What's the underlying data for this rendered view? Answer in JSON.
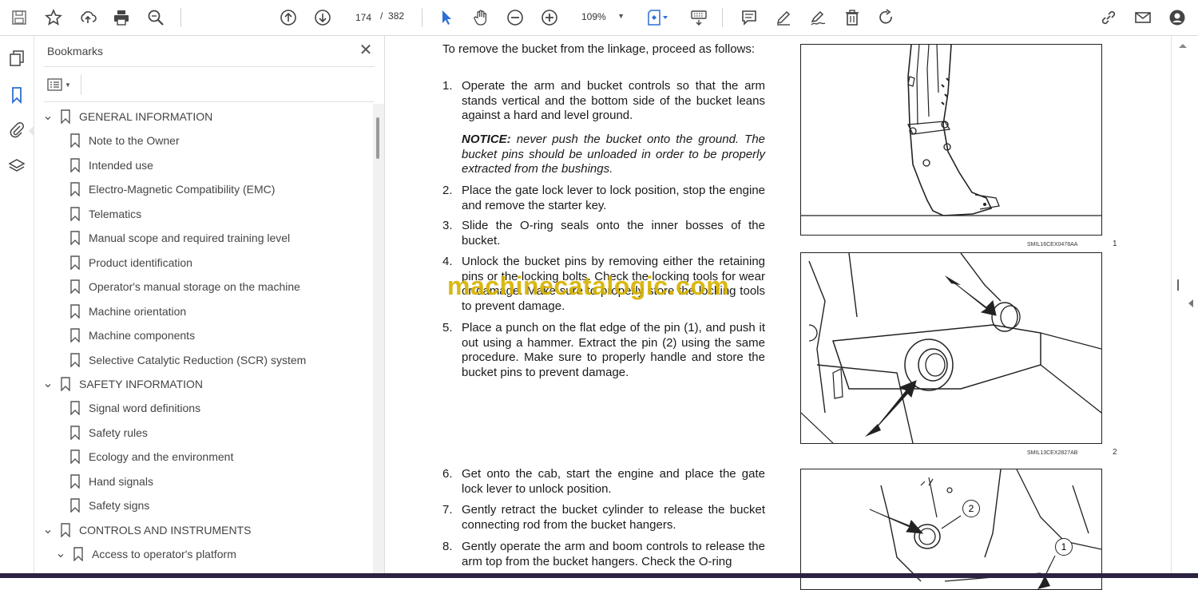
{
  "toolbar": {
    "icons": [
      "save-icon",
      "star-icon",
      "upload-icon",
      "print-icon",
      "zoom-search-icon",
      "page-up-icon",
      "page-down-icon",
      "select-cursor-icon",
      "hand-icon",
      "zoom-out-icon",
      "zoom-in-icon",
      "fit-page-icon",
      "keyboard-scroll-icon",
      "comment-icon",
      "pen-icon",
      "sign-icon",
      "delete-icon",
      "redo-icon",
      "share-link-icon",
      "mail-icon",
      "account-icon"
    ],
    "current_page": "174",
    "page_separator": "/",
    "total_pages": "382",
    "zoom": "109%"
  },
  "sidebar": {
    "title": "Bookmarks",
    "items": [
      {
        "label": "GENERAL INFORMATION",
        "level": 0,
        "expanded": true
      },
      {
        "label": "Note to the Owner",
        "level": 1
      },
      {
        "label": "Intended use",
        "level": 1
      },
      {
        "label": "Electro-Magnetic Compatibility (EMC)",
        "level": 1
      },
      {
        "label": "Telematics",
        "level": 1
      },
      {
        "label": "Manual scope and required training level",
        "level": 1
      },
      {
        "label": "Product identification",
        "level": 1
      },
      {
        "label": "Operator's manual storage on the machine",
        "level": 1
      },
      {
        "label": "Machine orientation",
        "level": 1
      },
      {
        "label": "Machine components",
        "level": 1
      },
      {
        "label": "Selective Catalytic Reduction (SCR) system",
        "level": 1
      },
      {
        "label": "SAFETY INFORMATION",
        "level": 0,
        "expanded": true
      },
      {
        "label": "Signal word definitions",
        "level": 1
      },
      {
        "label": "Safety rules",
        "level": 1
      },
      {
        "label": "Ecology and the environment",
        "level": 1
      },
      {
        "label": "Hand signals",
        "level": 1
      },
      {
        "label": "Safety signs",
        "level": 1
      },
      {
        "label": "CONTROLS AND INSTRUMENTS",
        "level": 0,
        "expanded": true
      },
      {
        "label": "Access to operator's platform",
        "level": 1,
        "expanded": true
      }
    ]
  },
  "document": {
    "intro": "To remove the bucket from the linkage, proceed as follows:",
    "steps": [
      {
        "n": "1.",
        "text": "Operate the arm and bucket controls so that the arm stands vertical and the bottom side of the bucket leans against a hard and level ground."
      },
      {
        "n": "",
        "label": "NOTICE:",
        "text": " never push the bucket onto the ground. The bucket pins should be unloaded in order to be properly extracted from the bushings."
      },
      {
        "n": "2.",
        "text": "Place the gate lock lever to lock position, stop the engine and remove the starter key."
      },
      {
        "n": "3.",
        "text": "Slide the O-ring seals onto the inner bosses of the bucket."
      },
      {
        "n": "4.",
        "text": "Unlock the bucket pins by removing either the retaining pins or the locking bolts. Check the locking tools for wear or damage. Make sure to properly store the locking tools to prevent damage."
      },
      {
        "n": "5.",
        "text": "Place a punch on the flat edge of the pin (1), and push it out using a hammer. Extract the pin (2) using the same procedure. Make sure to properly handle and store the bucket pins to prevent damage."
      },
      {
        "n": "6.",
        "text": "Get onto the cab, start the engine and place the gate lock lever to unlock position."
      },
      {
        "n": "7.",
        "text": "Gently retract the bucket cylinder to release the bucket connecting rod from the bucket hangers."
      },
      {
        "n": "8.",
        "text": "Gently operate the arm and boom controls to release the arm top from the bucket hangers. Check the O-ring"
      }
    ],
    "figures": [
      {
        "code": "SMIL16CEX0478AA",
        "number": "1"
      },
      {
        "code": "SMIL13CEX2827AB",
        "number": "2"
      },
      {
        "callouts": [
          "2",
          "1"
        ]
      }
    ],
    "watermark": "machinecatalogic.com"
  }
}
